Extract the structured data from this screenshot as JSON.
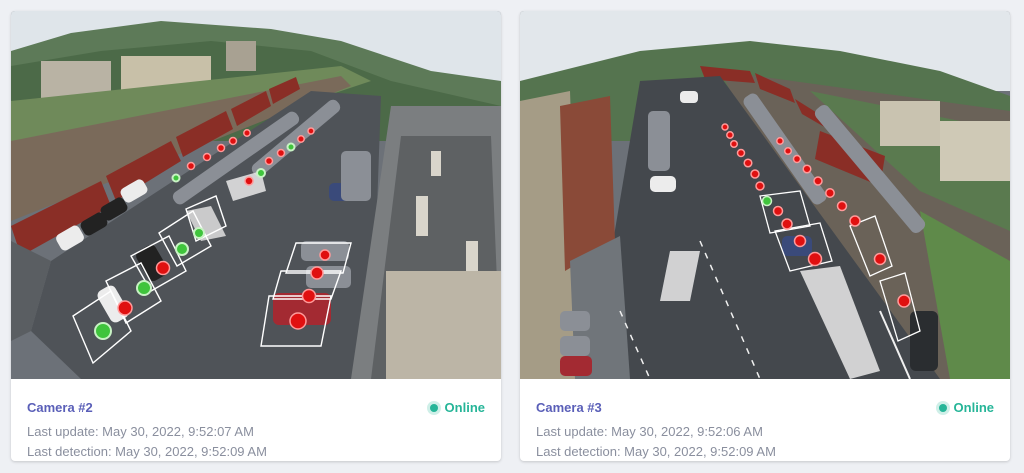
{
  "cameras": [
    {
      "name": "Camera #2",
      "status": "Online",
      "last_update": "Last update: May 30, 2022, 9:52:07 AM",
      "last_detection": "Last detection: May 30, 2022, 9:52:09 AM"
    },
    {
      "name": "Camera #3",
      "status": "Online",
      "last_update": "Last update: May 30, 2022, 9:52:06 AM",
      "last_detection": "Last detection: May 30, 2022, 9:52:09 AM"
    }
  ],
  "colors": {
    "accent": "#5a5fb8",
    "online": "#26b598",
    "meta_text": "#8a8f9e",
    "occupied_marker": "#e01010",
    "free_marker": "#3fc43c"
  }
}
